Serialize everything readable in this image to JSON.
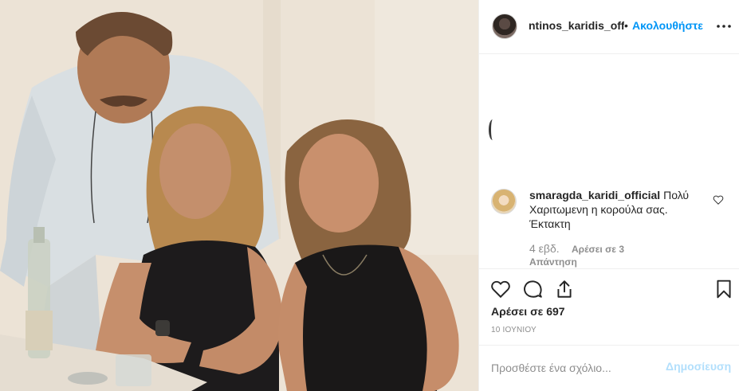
{
  "post": {
    "owner": {
      "username": "ntinos_karidis_official",
      "follow_label": "Ακολουθήστε",
      "separator": "•"
    },
    "photo": {
      "alt": "Φωτογραφία"
    },
    "comments": [
      {
        "username": "smaragda_karidi_official",
        "text": "Πολύ Χαριτωμενη η κορούλα σας. Έκτακτη",
        "time": "4 εβδ.",
        "likes": "Αρέσει σε 3",
        "reply_label": "Απάντηση"
      }
    ],
    "likes_label": "Αρέσει σε 697",
    "date": "10 ΙΟΥΝΙΟΥ",
    "add_comment": {
      "placeholder": "Προσθέστε ένα σχόλιο...",
      "post_label": "Δημοσίευση"
    },
    "icons": {
      "more": "more-options-icon",
      "like": "heart-icon",
      "comment": "comment-icon",
      "share": "share-icon",
      "save": "bookmark-icon",
      "comment_like": "small-heart-icon",
      "loading": "loading-spinner-icon"
    },
    "colors": {
      "link": "#0095f6",
      "post_button_disabled": "#b2dffc",
      "muted": "#8e8e8e",
      "border": "#efefef"
    }
  }
}
